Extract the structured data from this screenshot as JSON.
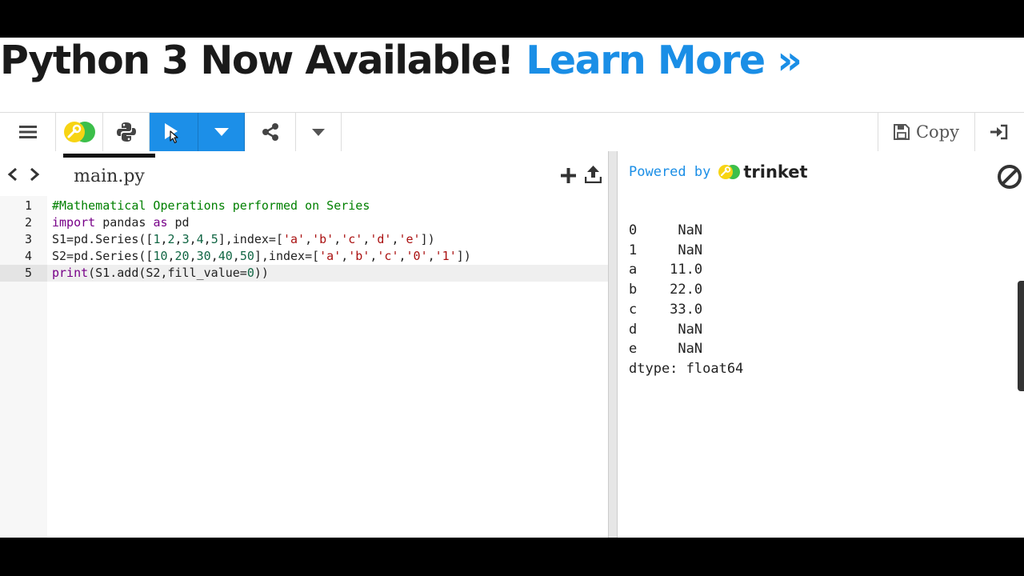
{
  "banner": {
    "prefix": "Python 3 Now Available! ",
    "link": "Learn More »"
  },
  "toolbar": {
    "copy_label": "Copy"
  },
  "editor": {
    "filename": "main.py",
    "line_numbers": [
      "1",
      "2",
      "3",
      "4",
      "5"
    ],
    "lines": [
      "#Mathematical Operations performed on Series",
      "import pandas as pd",
      "S1=pd.Series([1,2,3,4,5],index=['a','b','c','d','e'])",
      "S2=pd.Series([10,20,30,40,50],index=['a','b','c','0','1'])",
      "print(S1.add(S2,fill_value=0))"
    ],
    "active_line": 5
  },
  "output": {
    "powered_by": "Powered by",
    "brand": "trinket",
    "lines": [
      "0     NaN",
      "1     NaN",
      "a    11.0",
      "b    22.0",
      "c    33.0",
      "d     NaN",
      "e     NaN",
      "dtype: float64"
    ]
  },
  "icons": {
    "menu": "hamburger-icon",
    "logo": "trinket-logo-icon",
    "python": "python-icon",
    "run": "play-icon",
    "run_options": "caret-down-icon",
    "share": "share-icon",
    "more": "caret-down-icon",
    "copy": "floppy-disk-icon",
    "login": "sign-in-icon",
    "prev": "chevron-left-icon",
    "next": "chevron-right-icon",
    "add_file": "plus-icon",
    "upload": "upload-icon",
    "stop": "stop-icon"
  },
  "colors": {
    "accent": "#1c8fe8",
    "link": "#1a8ee6",
    "logo_yellow": "#f7d414",
    "logo_green": "#3cbf4a"
  }
}
